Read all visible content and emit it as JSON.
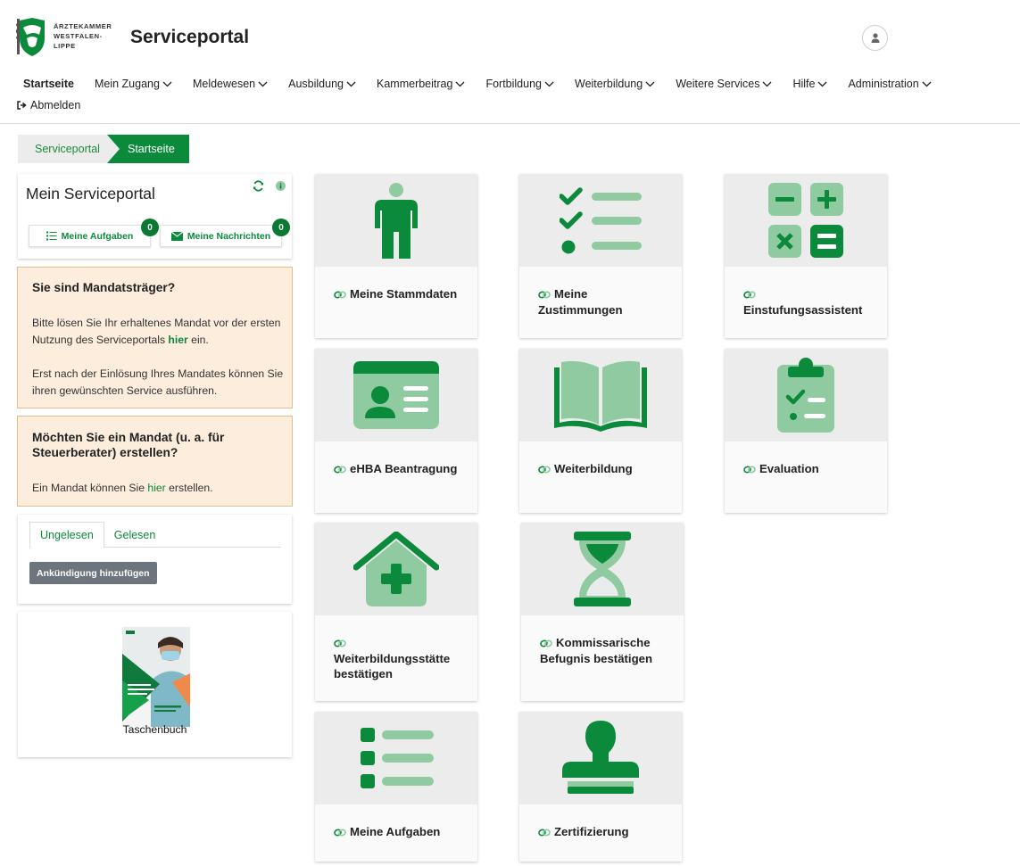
{
  "header": {
    "logo_line1": "ÄRZTEKAMMER",
    "logo_line2": "WESTFALEN-LIPPE",
    "title": "Serviceportal",
    "user_icon": "user-icon"
  },
  "nav": {
    "items": [
      {
        "label": "Startseite",
        "dropdown": false,
        "active": true
      },
      {
        "label": "Mein Zugang",
        "dropdown": true
      },
      {
        "label": "Meldewesen",
        "dropdown": true
      },
      {
        "label": "Ausbildung",
        "dropdown": true
      },
      {
        "label": "Kammerbeitrag",
        "dropdown": true
      },
      {
        "label": "Fortbildung",
        "dropdown": true
      },
      {
        "label": "Weiterbildung",
        "dropdown": true
      },
      {
        "label": "Weitere Services",
        "dropdown": true
      },
      {
        "label": "Hilfe",
        "dropdown": true
      },
      {
        "label": "Administration",
        "dropdown": true
      }
    ],
    "logout_label": "Abmelden"
  },
  "breadcrumb": {
    "items": [
      "Serviceportal",
      "Startseite"
    ]
  },
  "portal_panel": {
    "title": "Mein Serviceportal",
    "tasks_label": "Meine Aufgaben",
    "tasks_count": "0",
    "messages_label": "Meine Nachrichten",
    "messages_count": "0"
  },
  "notice_mandate": {
    "title": "Sie sind Mandatsträger?",
    "para1_before": "Bitte lösen Sie Ihr erhaltenes Mandat vor der ersten Nutzung des Serviceportals ",
    "para1_link": "hier",
    "para1_after": " ein.",
    "para2": "Erst nach der Einlösung Ihres Mandates können Sie ihren gewünschten Service ausführen."
  },
  "notice_create": {
    "title": "Möchten Sie ein Mandat (u. a. für Steuerberater) erstellen?",
    "text_before": "Ein Mandat können Sie ",
    "text_link": "hier",
    "text_after": " erstellen."
  },
  "announcements": {
    "tabs": [
      "Ungelesen",
      "Gelesen"
    ],
    "active_tab": "Ungelesen",
    "add_button": "Ankündigung hinzufügen"
  },
  "book": {
    "caption": "Taschenbuch"
  },
  "tiles": [
    {
      "label": "Meine Stammdaten",
      "icon": "person-icon"
    },
    {
      "label": "Meine Zustimmungen",
      "icon": "checklist-icon"
    },
    {
      "label": "Einstufungsassistent",
      "icon": "calculator-icon"
    },
    {
      "label": "eHBA Beantragung",
      "icon": "id-card-icon"
    },
    {
      "label": "Weiterbildung",
      "icon": "book-icon"
    },
    {
      "label": "Evaluation",
      "icon": "clipboard-icon"
    },
    {
      "label": "Weiterbildungsstätte bestätigen",
      "icon": "house-medical-icon"
    },
    {
      "label": "Kommissarische Befugnis bestätigen",
      "icon": "hourglass-icon"
    },
    {
      "label": "Meine Aufgaben",
      "icon": "task-list-icon"
    },
    {
      "label": "Zertifizierung",
      "icon": "stamp-icon"
    }
  ],
  "colors": {
    "primary": "#0a8a3a",
    "primary_light": "#8fcaa0",
    "notice_bg": "#fdeddd",
    "notice_border": "#e5bd8c"
  }
}
